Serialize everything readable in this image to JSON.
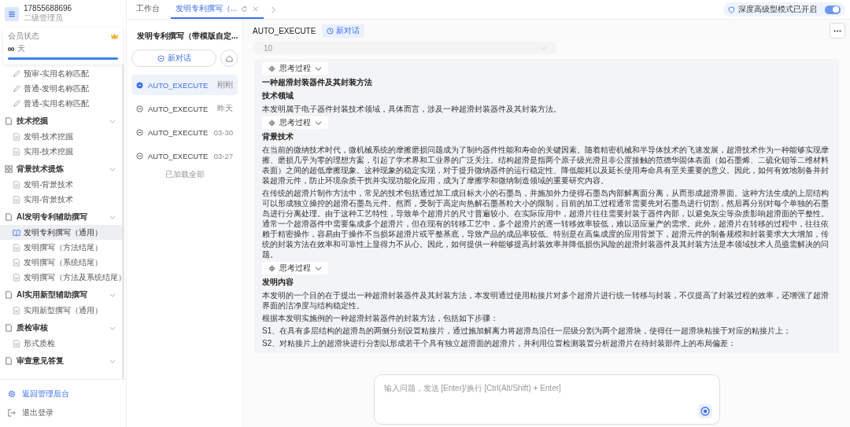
{
  "user": {
    "phone": "17855688696",
    "role": "二级管理员"
  },
  "membership": {
    "label": "会员状态",
    "days_symbol": "∞",
    "days_unit": "天",
    "level": 1
  },
  "sidebar": {
    "groups": [
      {
        "children": [
          {
            "label": "预审-实用名称匹配",
            "selected": false
          },
          {
            "label": "普通-发明名称匹配",
            "selected": false
          },
          {
            "label": "普通-实用名称匹配",
            "selected": false
          }
        ]
      },
      {
        "label": "技术挖掘",
        "children": [
          {
            "label": "发明-技术挖掘",
            "selected": false
          },
          {
            "label": "实用-技术挖掘",
            "selected": false
          }
        ]
      },
      {
        "label": "背景技术提炼",
        "children": [
          {
            "label": "发明-背景技术",
            "selected": false
          },
          {
            "label": "实用-背景技术",
            "selected": false
          }
        ]
      },
      {
        "label": "AI发明专利辅助撰写",
        "children": [
          {
            "label": "发明专利撰写（通用）",
            "selected": true
          },
          {
            "label": "发明撰写（方法结尾）",
            "selected": false
          },
          {
            "label": "发明撰写（系统结尾）",
            "selected": false
          },
          {
            "label": "发明撰写（方法及系统结尾）",
            "selected": false
          }
        ]
      },
      {
        "label": "AI实用新型辅助撰写",
        "children": [
          {
            "label": "实用新型撰写（通用）",
            "selected": false
          }
        ]
      },
      {
        "label": "质检审核",
        "children": [
          {
            "label": "形式质检",
            "selected": false
          }
        ]
      },
      {
        "label": "审查意见答复"
      }
    ],
    "footer": [
      {
        "label": "返回管理后台",
        "kind": "admin"
      },
      {
        "label": "退出登录",
        "kind": "logout"
      }
    ]
  },
  "tabs": [
    {
      "label": "工作台",
      "selected": false
    },
    {
      "label": "发明专利撰写（...",
      "selected": true
    }
  ],
  "mode_toggle": {
    "label": "深度高级型模式已开启",
    "on": true
  },
  "conversations": {
    "title": "发明专利撰写（带模版自定...",
    "new_button": "新对话",
    "items": [
      {
        "title": "AUTO_EXECUTE",
        "time": "刚刚",
        "selected": true
      },
      {
        "title": "AUTO_EXECUTE",
        "time": "昨天",
        "selected": false
      },
      {
        "title": "AUTO_EXECUTE",
        "time": "03-30",
        "selected": false
      },
      {
        "title": "AUTO_EXECUTE",
        "time": "03-27",
        "selected": false
      }
    ],
    "footer": "已加载全部"
  },
  "chat": {
    "title": "AUTO_EXECUTE",
    "new_chip": "新对话",
    "previous_value": "10",
    "blocks": [
      {
        "kind": "thinking",
        "text": "思考过程"
      },
      {
        "kind": "heading",
        "text": "一种超滑封装器件及其封装方法"
      },
      {
        "kind": "heading",
        "text": "技术领域"
      },
      {
        "kind": "paragraph",
        "text": "本发明属于电子器件封装技术领域，具体而言，涉及一种超滑封装器件及其封装方法。"
      },
      {
        "kind": "thinking",
        "text": "思考过程"
      },
      {
        "kind": "heading",
        "text": "背景技术"
      },
      {
        "kind": "paragraph",
        "text": "在当前的微纳技术时代，微机械系统的摩擦磨损问题成为了制约器件性能和寿命的关键因素。随着精密机械和半导体技术的飞速发展，超滑技术作为一种能够实现摩擦、磨损几乎为零的理想方案，引起了学术界和工业界的广泛关注。结构超滑是指两个原子级光滑且非公度接触的范德华固体表面（如石墨烯、二硫化钼等二维材料表面）之间的超低摩擦现象。这种现象的稳定实现，对于提升微纳器件的运行稳定性、降低能耗以及延长使用寿命具有至关重要的意义。因此，如何有效地制备并封装超滑元件，防止环境杂质干扰并实现功能化应用，成为了摩擦学和微纳制造领域的重要研究内容。"
      },
      {
        "kind": "paragraph",
        "text": "在传统的超滑片制作方法中，常见的技术包括通过加工成目标大小的石墨岛，并施加外力使得石墨岛内部解离面分离，从而形成超滑界面。这种方法生成的上层结构可以形成独立操控的超滑石墨岛元件。然而，受制于高定向热解石墨基粒大小的限制，目前的加工过程通常需要先对石墨岛进行切割，然后再分别对每个单独的石墨岛进行分离处理。由于这种工艺特性，导致单个超滑片的尺寸普遍较小。在实际应用中，超滑片往往需要封装于器件内部，以避免灰尘等杂质影响超滑面的平整性。通常一个超滑器件中需要集成多个超滑片，但在现有的转移工艺中，多个超滑片的逐一转移效率较低，难以适应量产的需求。此外，超滑片在转移的过程中，往往依赖于精密操作，容易由于操作不当损坏超滑片或平整基底，导致产品的成品率较低。特别是在高集成度的应用背景下，超滑元件的制备规模和封装要求大大增加，传统的封装方法在效率和可靠性上显得力不从心。因此，如何提供一种能够提高封装效率并降低损伤风险的超滑封装器件及其封装方法是本领域技术人员亟需解决的问题。"
      },
      {
        "kind": "thinking",
        "text": "思考过程"
      },
      {
        "kind": "heading",
        "text": "发明内容"
      },
      {
        "kind": "paragraph",
        "text": "本发明的一个目的在于提出一种超滑封装器件及其封装方法，本发明通过使用粘接片对多个超滑片进行统一转移与封装，不仅提高了封装过程的效率，还增强了超滑界面的洁净度与结构稳定性。"
      },
      {
        "kind": "paragraph",
        "text": "根据本发明实施例的一种超滑封装器件的封装方法，包括如下步骤："
      },
      {
        "kind": "paragraph",
        "text": "S1、在具有多层结构的超滑岛的两侧分别设置粘接片，通过施加解离力将超滑岛沿任一层级分割为两个超滑块，使得任一超滑块粘接于对应的粘接片上；"
      },
      {
        "kind": "paragraph",
        "text": "S2、对粘接片上的超滑块进行分割以形成若干个具有独立超滑面的超滑片，并利用位置检测装置分析超滑片在待封装部件上的布局偏差："
      }
    ],
    "input": {
      "placeholder": "输入问题，发送 [Enter]/换行 [Ctrl(Alt/Shift) + Enter]"
    }
  }
}
